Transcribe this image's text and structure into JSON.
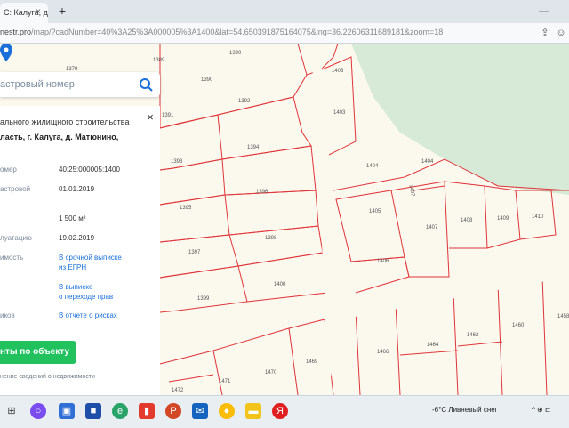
{
  "browser": {
    "tab_title": "С: Калуга, д.",
    "tab_close": "×",
    "new_tab": "+",
    "minimize": "—",
    "url_host": "nestr.pro",
    "url_rest": "/map/?cadNumber=40%3A25%3A000005%3A1400&lat=54.650391875164075&lng=36.22606311689181&zoom=18",
    "icons": [
      "share-icon",
      "profile-icon"
    ]
  },
  "search": {
    "placeholder": "астровый номер"
  },
  "card": {
    "subtitle": "ального жилищного строительства",
    "title": "ласть, г. Калуга, д. Матюнино,",
    "rows": [
      {
        "key": "омер",
        "value": "40:25:000005:1400"
      },
      {
        "key": "астровой",
        "value": "01.01.2019"
      },
      {
        "key": "",
        "value": "1 500 м²"
      },
      {
        "key": "луатацию",
        "value": "19.02.2019"
      },
      {
        "key": "имость",
        "link1": "В срочной выписке",
        "link2": "из ЕГРН"
      },
      {
        "key": "",
        "link1": "В выписке",
        "link2": "о переходе прав"
      },
      {
        "key": "иков",
        "link1": "В отчете о рисках"
      }
    ],
    "docs_button": "нты по объекту",
    "footer": "нение сведений о недвижимости"
  },
  "map": {
    "plots": [
      {
        "n": "1378"
      },
      {
        "n": "1379"
      },
      {
        "n": "1389"
      },
      {
        "n": "1390"
      },
      {
        "n": "1390"
      },
      {
        "n": "1391"
      },
      {
        "n": "1392"
      },
      {
        "n": "1393"
      },
      {
        "n": "1394"
      },
      {
        "n": "1395"
      },
      {
        "n": "1396"
      },
      {
        "n": "1397"
      },
      {
        "n": "1398"
      },
      {
        "n": "1399"
      },
      {
        "n": "1400"
      },
      {
        "n": "1403"
      },
      {
        "n": "1403"
      },
      {
        "n": "1404"
      },
      {
        "n": "1404"
      },
      {
        "n": "1405"
      },
      {
        "n": "1406"
      },
      {
        "n": "1407"
      },
      {
        "n": "1407"
      },
      {
        "n": "1408"
      },
      {
        "n": "1409"
      },
      {
        "n": "1410"
      },
      {
        "n": "1458"
      },
      {
        "n": "1460"
      },
      {
        "n": "1462"
      },
      {
        "n": "1464"
      },
      {
        "n": "1466"
      },
      {
        "n": "1469"
      },
      {
        "n": "1470"
      },
      {
        "n": "1471"
      },
      {
        "n": "1472"
      }
    ],
    "colors": {
      "boundary": "#e0343a",
      "green": "#d7ead7",
      "road": "#fbf8ee"
    }
  },
  "taskbar": {
    "apps": [
      "start-icon",
      "taskview-icon",
      "search-icon",
      "zoom-icon",
      "store-icon",
      "edge-icon",
      "office-icon",
      "powerpoint-icon",
      "mail-icon",
      "chrome-icon",
      "explorer-icon",
      "yandex-icon"
    ],
    "weather": "-6°C  Ливневый снег",
    "tray": "^ ⊕ ⊏"
  }
}
